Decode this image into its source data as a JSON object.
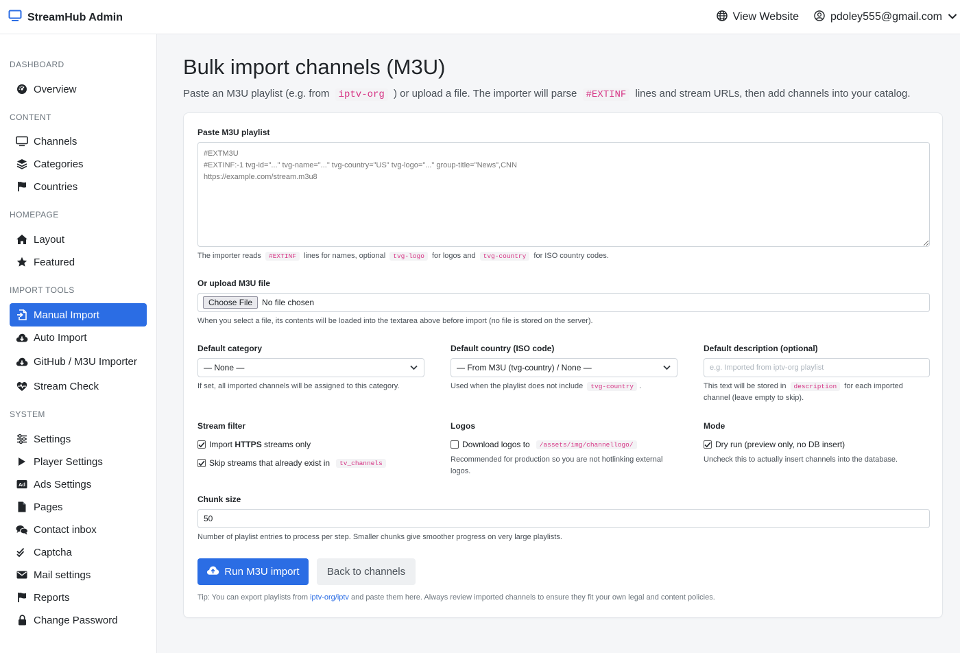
{
  "app": {
    "title": "StreamHub Admin"
  },
  "topnav": {
    "view_website": "View Website",
    "user_email": "pdoley555@gmail.com"
  },
  "sidebar": {
    "sections": [
      {
        "title": "DASHBOARD",
        "items": [
          {
            "label": "Overview",
            "icon": "dashboard-icon"
          }
        ]
      },
      {
        "title": "CONTENT",
        "items": [
          {
            "label": "Channels",
            "icon": "monitor-icon"
          },
          {
            "label": "Categories",
            "icon": "layers-icon"
          },
          {
            "label": "Countries",
            "icon": "flag-icon"
          }
        ]
      },
      {
        "title": "HOMEPAGE",
        "items": [
          {
            "label": "Layout",
            "icon": "home-icon"
          },
          {
            "label": "Featured",
            "icon": "star-icon"
          }
        ]
      },
      {
        "title": "IMPORT TOOLS",
        "items": [
          {
            "label": "Manual Import",
            "icon": "file-import-icon",
            "active": true
          },
          {
            "label": "Auto Import",
            "icon": "cloud-download-icon"
          },
          {
            "label": "GitHub / M3U Importer",
            "icon": "cloud-download-icon"
          },
          {
            "label": "Stream Check",
            "icon": "heart-pulse-icon"
          }
        ]
      },
      {
        "title": "SYSTEM",
        "items": [
          {
            "label": "Settings",
            "icon": "sliders-icon"
          },
          {
            "label": "Player Settings",
            "icon": "play-icon"
          },
          {
            "label": "Ads Settings",
            "icon": "ad-icon"
          },
          {
            "label": "Pages",
            "icon": "file-icon"
          },
          {
            "label": "Contact inbox",
            "icon": "chat-icon"
          },
          {
            "label": "Captcha",
            "icon": "check-double-icon"
          },
          {
            "label": "Mail settings",
            "icon": "envelope-icon"
          },
          {
            "label": "Reports",
            "icon": "flag-icon"
          },
          {
            "label": "Change Password",
            "icon": "lock-icon"
          }
        ]
      }
    ]
  },
  "page": {
    "title": "Bulk import channels (M3U)",
    "intro": {
      "p1": "Paste an M3U playlist (e.g. from",
      "code1": "iptv-org",
      "p2": ") or upload a file. The importer will parse",
      "code2": "#EXTINF",
      "p3": "lines and stream URLs, then add channels into your catalog."
    }
  },
  "form": {
    "playlist": {
      "label": "Paste M3U playlist",
      "placeholder": "#EXTM3U\n#EXTINF:-1 tvg-id=\"...\" tvg-name=\"...\" tvg-country=\"US\" tvg-logo=\"...\" group-title=\"News\",CNN\nhttps://example.com/stream.m3u8",
      "help": {
        "p1": "The importer reads",
        "c1": "#EXTINF",
        "p2": "lines for names, optional",
        "c2": "tvg-logo",
        "p3": "for logos and",
        "c3": "tvg-country",
        "p4": "for ISO country codes."
      }
    },
    "upload": {
      "label": "Or upload M3U file",
      "button": "Choose File",
      "status": "No file chosen",
      "help": "When you select a file, its contents will be loaded into the textarea above before import (no file is stored on the server)."
    },
    "category": {
      "label": "Default category",
      "value": "— None —",
      "help": "If set, all imported channels will be assigned to this category."
    },
    "country": {
      "label": "Default country (ISO code)",
      "value": "— From M3U (tvg-country) / None —",
      "help_p1": "Used when the playlist does not include",
      "help_code": "tvg-country",
      "help_p2": "."
    },
    "description": {
      "label": "Default description (optional)",
      "placeholder": "e.g. Imported from iptv-org playlist",
      "help_p1": "This text will be stored in",
      "help_code": "description",
      "help_p2": "for each imported",
      "help_p3": "channel (leave empty to skip)."
    },
    "stream_filter": {
      "label": "Stream filter",
      "https": {
        "pre": "Import",
        "bold": "HTTPS",
        "post": "streams only",
        "checked": true
      },
      "skip": {
        "text": "Skip streams that already exist in",
        "code": "tv_channels",
        "checked": true
      }
    },
    "logos": {
      "label": "Logos",
      "download": {
        "text": "Download logos to",
        "code": "/assets/img/channellogo/",
        "checked": false
      },
      "help": "Recommended for production so you are not hotlinking external logos."
    },
    "mode": {
      "label": "Mode",
      "dry_run": {
        "text": "Dry run (preview only, no DB insert)",
        "checked": true
      },
      "help": "Uncheck this to actually insert channels into the database."
    },
    "chunk": {
      "label": "Chunk size",
      "value": "50",
      "help": "Number of playlist entries to process per step. Smaller chunks give smoother progress on very large playlists."
    },
    "run_button": "Run M3U import",
    "back_button": "Back to channels",
    "tip": {
      "p1": "Tip: You can export playlists from",
      "link": "iptv-org/iptv",
      "p2": "and paste them here. Always review imported channels to ensure they fit your own legal and content policies."
    }
  },
  "colors": {
    "primary": "#2b6de4",
    "code": "#d63384"
  }
}
